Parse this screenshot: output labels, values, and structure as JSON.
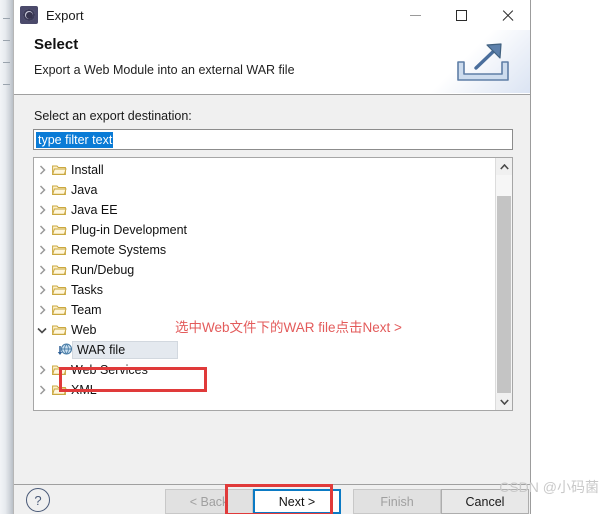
{
  "window": {
    "title": "Export",
    "app_icon": "export-gear-icon",
    "controls": {
      "minimize": "minimize-icon",
      "maximize": "maximize-icon",
      "close": "close-icon"
    }
  },
  "banner": {
    "title": "Select",
    "subtitle": "Export a Web Module into an external WAR file",
    "icon": "export-arrow-icon"
  },
  "form": {
    "label": "Select an export destination:",
    "filter": {
      "value": "type filter text",
      "placeholder": "type filter text",
      "selected": true
    }
  },
  "tree": {
    "items": [
      {
        "label": "Install",
        "expanded": false,
        "indent": 0,
        "icon": "folder-icon",
        "selected": false
      },
      {
        "label": "Java",
        "expanded": false,
        "indent": 0,
        "icon": "folder-icon",
        "selected": false
      },
      {
        "label": "Java EE",
        "expanded": false,
        "indent": 0,
        "icon": "folder-icon",
        "selected": false
      },
      {
        "label": "Plug-in Development",
        "expanded": false,
        "indent": 0,
        "icon": "folder-icon",
        "selected": false
      },
      {
        "label": "Remote Systems",
        "expanded": false,
        "indent": 0,
        "icon": "folder-icon",
        "selected": false
      },
      {
        "label": "Run/Debug",
        "expanded": false,
        "indent": 0,
        "icon": "folder-icon",
        "selected": false
      },
      {
        "label": "Tasks",
        "expanded": false,
        "indent": 0,
        "icon": "folder-icon",
        "selected": false
      },
      {
        "label": "Team",
        "expanded": false,
        "indent": 0,
        "icon": "folder-icon",
        "selected": false
      },
      {
        "label": "Web",
        "expanded": true,
        "indent": 0,
        "icon": "folder-icon",
        "selected": false
      },
      {
        "label": "WAR file",
        "expanded": null,
        "indent": 1,
        "icon": "war-file-icon",
        "selected": true
      },
      {
        "label": "Web Services",
        "expanded": false,
        "indent": 0,
        "icon": "folder-icon",
        "selected": false
      },
      {
        "label": "XML",
        "expanded": false,
        "indent": 0,
        "icon": "folder-icon",
        "selected": false
      }
    ],
    "scrollbar": {
      "up": "scroll-up-arrow-icon",
      "down": "scroll-down-arrow-icon"
    }
  },
  "annotations": {
    "instruction_text": "选中Web文件下的WAR file点击Next >",
    "color": "#e03a3a",
    "text_color": "#e35b5b"
  },
  "buttons": {
    "help": "?",
    "back": "< Back",
    "next": "Next >",
    "finish": "Finish",
    "cancel": "Cancel"
  },
  "watermark": "CSDN @小码菌"
}
